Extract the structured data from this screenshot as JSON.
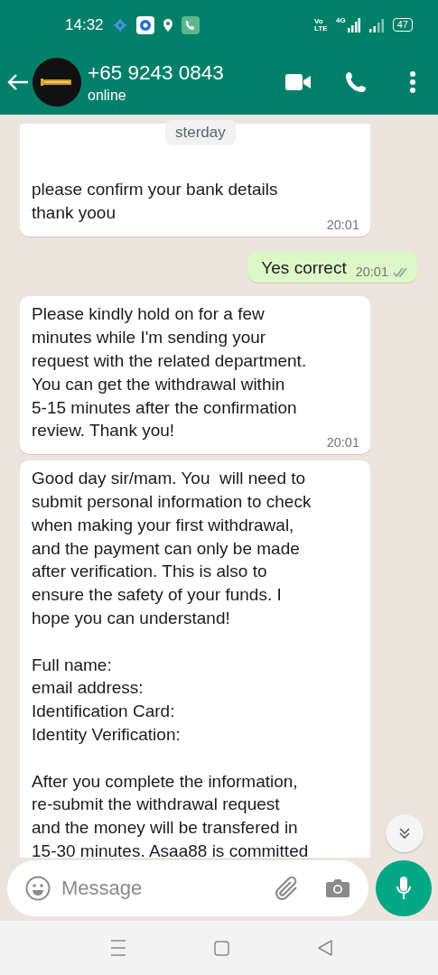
{
  "status_bar": {
    "time": "14:32",
    "volte": "Vo LTE",
    "network": "4G",
    "battery": "47"
  },
  "header": {
    "title": "+65 9243 0843",
    "subtitle": "online"
  },
  "date_chip": "sterday",
  "messages": [
    {
      "kind": "incoming",
      "redacted_top": true,
      "text": "please confirm your bank details\nthank yoou",
      "time": "20:01"
    },
    {
      "kind": "outgoing",
      "text": "Yes correct",
      "time": "20:01",
      "read": false
    },
    {
      "kind": "incoming",
      "text": "Please kindly hold on for a few\nminutes while I'm sending your\nrequest with the related department.\nYou can get the withdrawal within\n5-15 minutes after the confirmation\nreview. Thank you!",
      "time": "20:01"
    },
    {
      "kind": "incoming",
      "text": "Good day sir/mam. You  will need to\nsubmit personal information to check\nwhen making your first withdrawal,\nand the payment can only be made\nafter verification. This is also to\nensure the safety of your funds. I\nhope you can understand!\n\nFull name:\nemail address:\nIdentification Card:\nIdentity Verification:\n\nAfter you complete the information,\nre-submit the withdrawal request\nand the money will be transfered in\n15-30 minutes. Asaa88 is committed"
    }
  ],
  "composer": {
    "placeholder": "Message"
  }
}
